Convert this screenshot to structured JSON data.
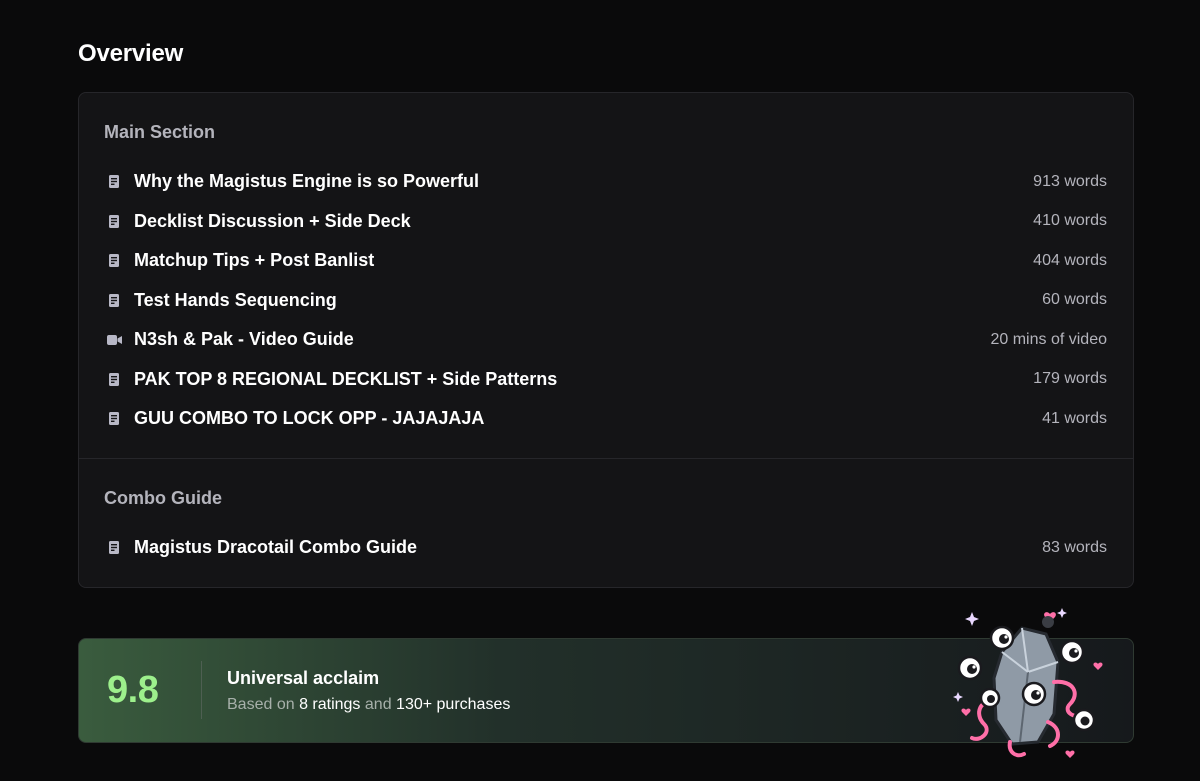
{
  "overview": {
    "title": "Overview"
  },
  "sections": [
    {
      "heading": "Main Section",
      "items": [
        {
          "icon": "document-icon",
          "title": "Why the Magistus Engine is so Powerful",
          "meta": "913 words"
        },
        {
          "icon": "document-icon",
          "title": "Decklist Discussion + Side Deck",
          "meta": "410 words"
        },
        {
          "icon": "document-icon",
          "title": "Matchup Tips + Post Banlist",
          "meta": "404 words"
        },
        {
          "icon": "document-icon",
          "title": "Test Hands Sequencing",
          "meta": "60 words"
        },
        {
          "icon": "video-camera-icon",
          "title": "N3sh & Pak - Video Guide",
          "meta": "20 mins of video"
        },
        {
          "icon": "document-icon",
          "title": "PAK TOP 8 REGIONAL DECKLIST + Side Patterns",
          "meta": "179 words"
        },
        {
          "icon": "document-icon",
          "title": "GUU COMBO TO LOCK OPP - JAJAJAJA",
          "meta": "41 words"
        }
      ]
    },
    {
      "heading": "Combo Guide",
      "items": [
        {
          "icon": "document-icon",
          "title": "Magistus Dracotail Combo Guide",
          "meta": "83 words"
        }
      ]
    }
  ],
  "rating": {
    "score": "9.8",
    "label": "Universal acclaim",
    "sub_prefix": "Based on",
    "ratings": "8 ratings",
    "sub_mid": "and",
    "purchases": "130+ purchases",
    "accent_color": "#9df08c"
  },
  "mascot": {
    "icon": "crystal-eyes-mascot-icon"
  }
}
